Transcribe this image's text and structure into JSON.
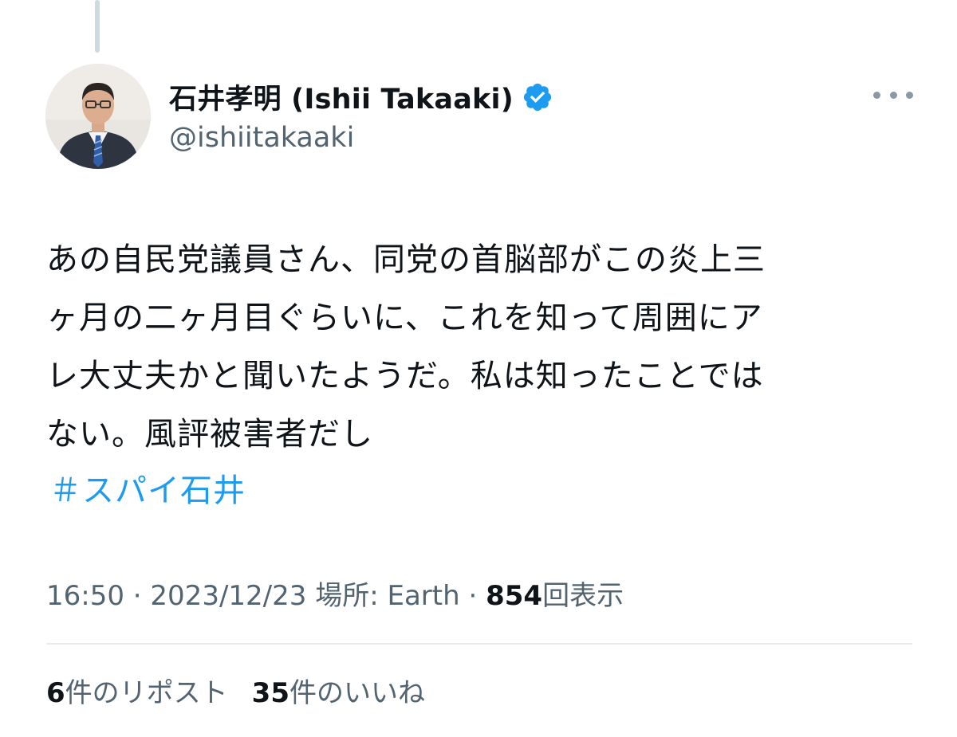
{
  "tweet": {
    "author": {
      "display_name": "石井孝明 (Ishii Takaaki)",
      "handle": "@ishiitakaaki",
      "verified": true,
      "avatar": "avatar-photo"
    },
    "text_lines": [
      "あの自民党議員さん、同党の首脳部がこの炎上三",
      "ヶ月の二ヶ月目ぐらいに、これを知って周囲にア",
      "レ大丈夫かと聞いたようだ。私は知ったことでは",
      "ない。風評被害者だし"
    ],
    "hashtag": "＃スパイ石井",
    "meta": {
      "time": "16:50",
      "sep1": " · ",
      "date": "2023/12/23",
      "location_label": " 場所: ",
      "location": "Earth",
      "sep2": " · ",
      "views_count": "854",
      "views_label": "回表示"
    },
    "stats": {
      "reposts_count": "6",
      "reposts_label": "件のリポスト",
      "likes_count": "35",
      "likes_label": "件のいいね"
    }
  },
  "icons": {
    "verified": "verified-badge-icon",
    "more": "more-horizontal-icon"
  },
  "colors": {
    "link": "#1d9bf0",
    "secondary_text": "#536471",
    "primary_text": "#0f1419",
    "verified_badge": "#1d9bf0",
    "divider": "#e6ecf0"
  }
}
